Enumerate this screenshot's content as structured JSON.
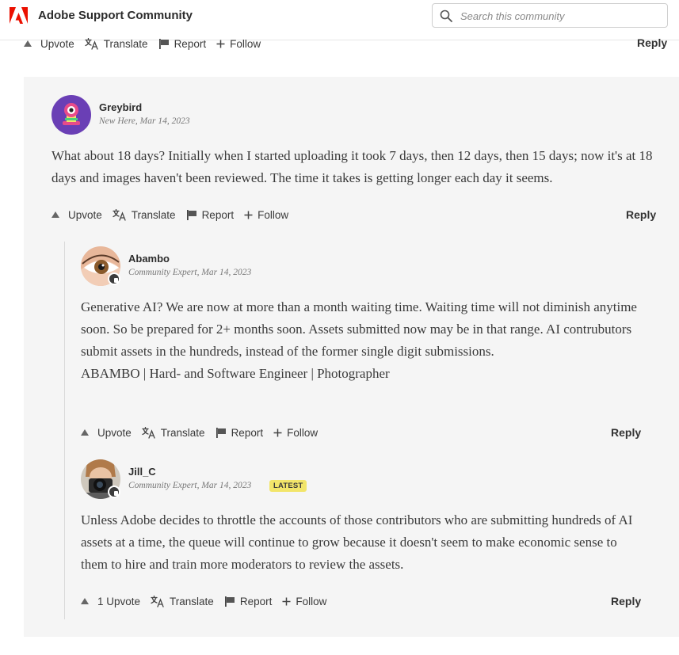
{
  "header": {
    "brand": "Adobe Support Community",
    "search_placeholder": "Search this community"
  },
  "top_action_bar": {
    "upvote": "Upvote",
    "translate": "Translate",
    "report": "Report",
    "follow": "Follow",
    "reply": "Reply"
  },
  "posts": [
    {
      "author": "Greybird",
      "rank": "New Here",
      "date": "Mar 14, 2023",
      "body": "What about 18 days? Initially when I started uploading it took 7 days, then 12 days, then 15 days; now it's at 18 days and images haven't been reviewed. The time it takes is getting longer each day it seems.",
      "actions": {
        "upvote": "Upvote",
        "translate": "Translate",
        "report": "Report",
        "follow": "Follow",
        "reply": "Reply"
      }
    },
    {
      "author": "Abambo",
      "rank": "Community Expert",
      "date": "Mar 14, 2023",
      "body": "Generative AI? We are now at more than a month waiting time. Waiting time will not diminish anytime soon. So be prepared for 2+ months soon. Assets submitted now may be in that range. AI contrubutors submit assets in the hundreds, instead of the former single digit submissions.",
      "signature": "ABAMBO | Hard- and Software Engineer | Photographer",
      "actions": {
        "upvote": "Upvote",
        "translate": "Translate",
        "report": "Report",
        "follow": "Follow",
        "reply": "Reply"
      }
    },
    {
      "author": "Jill_C",
      "rank": "Community Expert",
      "date": "Mar 14, 2023",
      "badge": "LATEST",
      "body": "Unless Adobe decides to throttle the accounts of those contributors who are submitting hundreds of AI assets at a time, the queue will continue to grow because it doesn't seem to make economic sense to them to hire and train more moderators to review the assets.",
      "actions": {
        "upvote": "1 Upvote",
        "translate": "Translate",
        "report": "Report",
        "follow": "Follow",
        "reply": "Reply"
      }
    }
  ],
  "icons": [
    "adobe-logo",
    "search-icon",
    "upvote-icon",
    "translate-icon",
    "report-flag-icon",
    "follow-plus-icon",
    "expert-badge-icon"
  ],
  "colors": {
    "brand_red": "#eb1000",
    "card_bg": "#f5f5f5",
    "latest_badge": "#f2e56a"
  }
}
